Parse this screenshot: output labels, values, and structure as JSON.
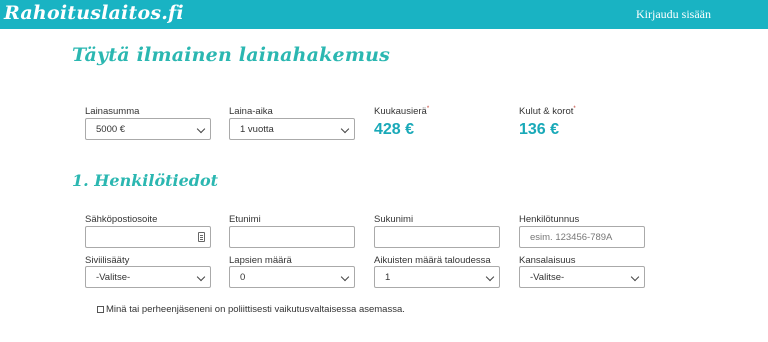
{
  "header": {
    "logo": "Rahoituslaitos.fi",
    "login_label": "Kirjaudu sisään"
  },
  "main": {
    "title": "Täytä ilmainen lainahakemus",
    "loan": {
      "amount_label": "Lainasumma",
      "amount_value": "5000 €",
      "term_label": "Laina-aika",
      "term_value": "1 vuotta",
      "monthly_label": "Kuukausierä",
      "monthly_value": "428 €",
      "costs_label": "Kulut & korot",
      "costs_value": "136 €",
      "footnote_mark": "*"
    },
    "section1": {
      "title": "1. Henkilötiedot",
      "email_label": "Sähköpostiosoite",
      "email_value": "",
      "firstname_label": "Etunimi",
      "firstname_value": "",
      "lastname_label": "Sukunimi",
      "lastname_value": "",
      "ssn_label": "Henkilötunnus",
      "ssn_placeholder": "esim. 123456-789A",
      "marital_label": "Siviilisääty",
      "marital_value": "-Valitse-",
      "children_label": "Lapsien määrä",
      "children_value": "0",
      "adults_label": "Aikuisten määrä taloudessa",
      "adults_value": "1",
      "citizenship_label": "Kansalaisuus",
      "citizenship_value": "-Valitse-",
      "pep_label": "Minä tai perheenjäseneni on poliittisesti vaikutusvaltaisessa asemassa."
    }
  }
}
